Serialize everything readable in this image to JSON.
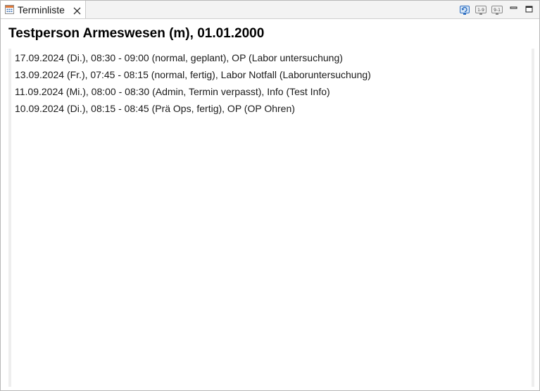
{
  "tab": {
    "label": "Terminliste",
    "icon": "calendar-list-icon",
    "close_icon": "close-icon"
  },
  "toolbar": {
    "buttons": [
      {
        "name": "refresh-icon"
      },
      {
        "name": "sort-ascending-icon"
      },
      {
        "name": "sort-descending-icon"
      },
      {
        "name": "minimize-icon"
      },
      {
        "name": "maximize-icon"
      }
    ]
  },
  "header": {
    "title": "Testperson Armeswesen (m), 01.01.2000"
  },
  "appointments": [
    "17.09.2024 (Di.), 08:30 - 09:00 (normal, geplant), OP (Labor untersuchung)",
    "13.09.2024 (Fr.), 07:45 - 08:15 (normal, fertig), Labor Notfall (Laboruntersuchung)",
    "11.09.2024 (Mi.), 08:00 - 08:30 (Admin, Termin verpasst), Info (Test Info)",
    "10.09.2024 (Di.), 08:15 - 08:45 (Prä Ops, fertig), OP (OP Ohren)"
  ],
  "colors": {
    "accent_blue": "#2f6fc1",
    "border": "#b7b7b7"
  }
}
